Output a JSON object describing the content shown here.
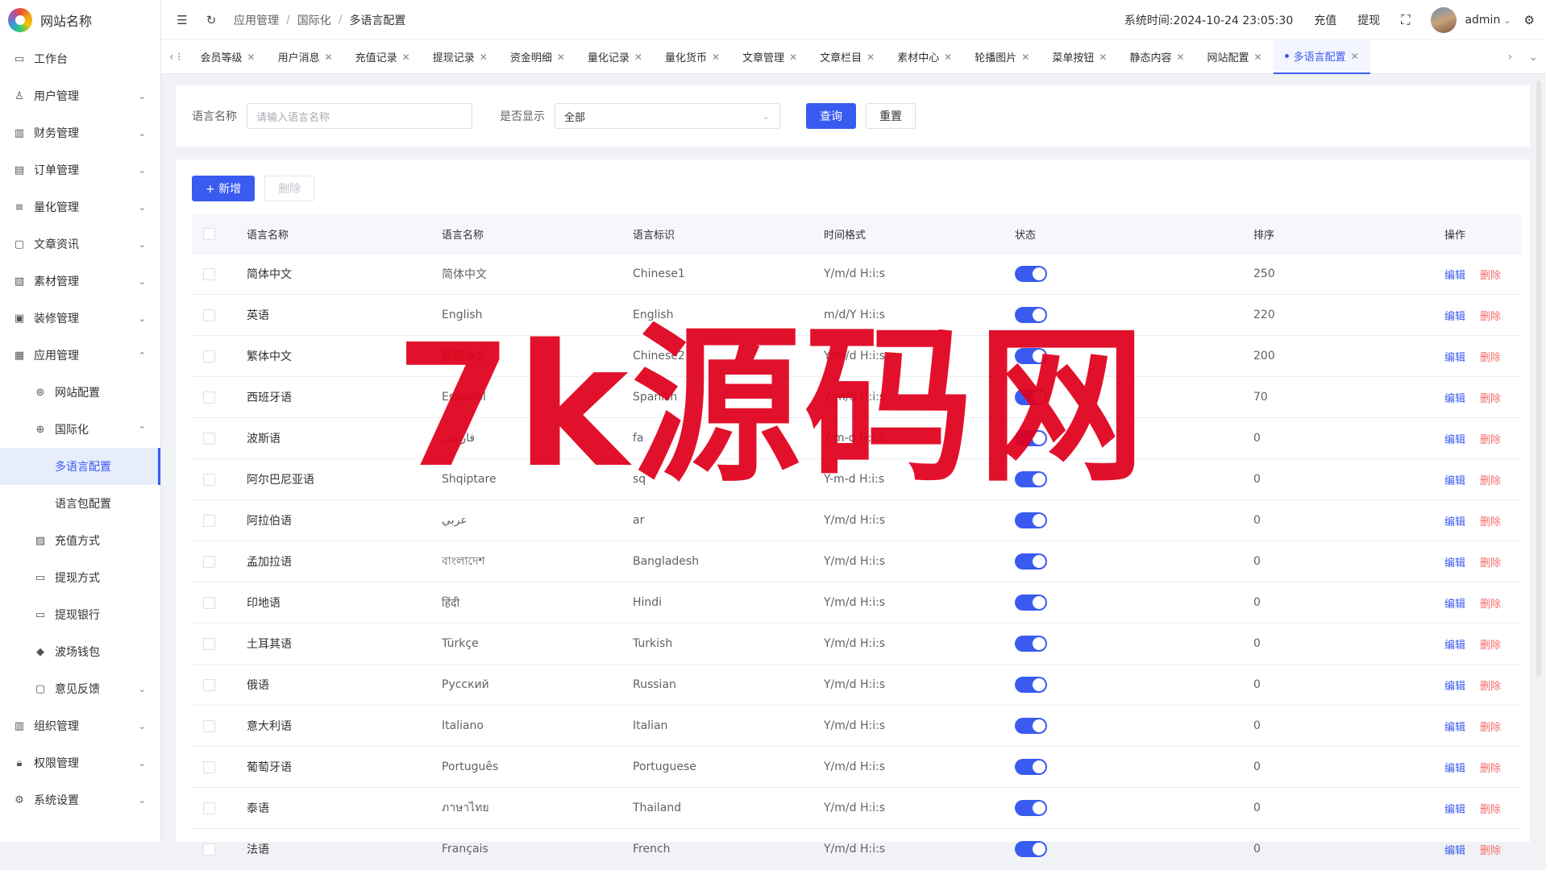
{
  "sidebar": {
    "logo_text": "网站名称",
    "items": [
      {
        "label": "工作台",
        "icon": "▭",
        "chevron": ""
      },
      {
        "label": "用户管理",
        "icon": "♙",
        "chevron": "⌄"
      },
      {
        "label": "财务管理",
        "icon": "▥",
        "chevron": "⌄"
      },
      {
        "label": "订单管理",
        "icon": "▤",
        "chevron": "⌄"
      },
      {
        "label": "量化管理",
        "icon": "≡",
        "chevron": "⌄"
      },
      {
        "label": "文章资讯",
        "icon": "▢",
        "chevron": "⌄"
      },
      {
        "label": "素材管理",
        "icon": "▧",
        "chevron": "⌄"
      },
      {
        "label": "装修管理",
        "icon": "▣",
        "chevron": "⌄"
      },
      {
        "label": "应用管理",
        "icon": "▦",
        "chevron": "⌃"
      }
    ],
    "sub_items": [
      {
        "label": "网站配置",
        "icon": "⊛",
        "level": 1,
        "chevron": ""
      },
      {
        "label": "国际化",
        "icon": "⊕",
        "level": 1,
        "chevron": "⌃"
      },
      {
        "label": "多语言配置",
        "icon": "",
        "level": 2,
        "chevron": "",
        "active": true
      },
      {
        "label": "语言包配置",
        "icon": "",
        "level": 2,
        "chevron": ""
      },
      {
        "label": "充值方式",
        "icon": "▨",
        "level": 1,
        "chevron": ""
      },
      {
        "label": "提现方式",
        "icon": "▭",
        "level": 1,
        "chevron": ""
      },
      {
        "label": "提现银行",
        "icon": "▭",
        "level": 1,
        "chevron": ""
      },
      {
        "label": "波场钱包",
        "icon": "◆",
        "level": 1,
        "chevron": ""
      },
      {
        "label": "意见反馈",
        "icon": "▢",
        "level": 1,
        "chevron": "⌄"
      }
    ],
    "bottom_items": [
      {
        "label": "组织管理",
        "icon": "▥",
        "chevron": "⌄"
      },
      {
        "label": "权限管理",
        "icon": "🔒︎",
        "chevron": "⌄"
      },
      {
        "label": "系统设置",
        "icon": "⚙",
        "chevron": "⌄"
      }
    ]
  },
  "topbar": {
    "breadcrumb": [
      "应用管理",
      "国际化",
      "多语言配置"
    ],
    "system_time_label": "系统时间:",
    "system_time": "2024-10-24 23:05:30",
    "recharge": "充值",
    "withdraw": "提现",
    "username": "admin"
  },
  "tabs": [
    {
      "label": "会员等级"
    },
    {
      "label": "用户消息"
    },
    {
      "label": "充值记录"
    },
    {
      "label": "提现记录"
    },
    {
      "label": "资金明细"
    },
    {
      "label": "量化记录"
    },
    {
      "label": "量化货币"
    },
    {
      "label": "文章管理"
    },
    {
      "label": "文章栏目"
    },
    {
      "label": "素材中心"
    },
    {
      "label": "轮播图片"
    },
    {
      "label": "菜单按钮"
    },
    {
      "label": "静态内容"
    },
    {
      "label": "网站配置"
    },
    {
      "label": "多语言配置",
      "active": true
    }
  ],
  "search": {
    "name_label": "语言名称",
    "name_placeholder": "请输入语言名称",
    "show_label": "是否显示",
    "show_value": "全部",
    "query_button": "查询",
    "reset_button": "重置"
  },
  "actions": {
    "add_button": "+ 新增",
    "delete_button": "删除"
  },
  "table": {
    "headers": [
      "语言名称",
      "语言名称",
      "语言标识",
      "时间格式",
      "状态",
      "排序",
      "操作"
    ],
    "rows": [
      {
        "name": "简体中文",
        "native": "简体中文",
        "code": "Chinese1",
        "fmt": "Y/m/d H:i:s",
        "sort": "250"
      },
      {
        "name": "英语",
        "native": "English",
        "code": "English",
        "fmt": "m/d/Y H:i:s",
        "sort": "220"
      },
      {
        "name": "繁体中文",
        "native": "繁體中文",
        "code": "Chinese2",
        "fmt": "Y/m/d H:i:s",
        "sort": "200"
      },
      {
        "name": "西班牙语",
        "native": "Español",
        "code": "Spanish",
        "fmt": "Y/m/d H:i:s",
        "sort": "70"
      },
      {
        "name": "波斯语",
        "native": "فارسی",
        "code": "fa",
        "fmt": "Y-m-d H:i:s",
        "sort": "0"
      },
      {
        "name": "阿尔巴尼亚语",
        "native": "Shqiptare",
        "code": "sq",
        "fmt": "Y-m-d H:i:s",
        "sort": "0"
      },
      {
        "name": "阿拉伯语",
        "native": "عربي",
        "code": "ar",
        "fmt": "Y/m/d H:i:s",
        "sort": "0"
      },
      {
        "name": "孟加拉语",
        "native": "বাংলাদেশ",
        "code": "Bangladesh",
        "fmt": "Y/m/d H:i:s",
        "sort": "0"
      },
      {
        "name": "印地语",
        "native": "हिंदी",
        "code": "Hindi",
        "fmt": "Y/m/d H:i:s",
        "sort": "0"
      },
      {
        "name": "土耳其语",
        "native": "Türkçe",
        "code": "Turkish",
        "fmt": "Y/m/d H:i:s",
        "sort": "0"
      },
      {
        "name": "俄语",
        "native": "Русский",
        "code": "Russian",
        "fmt": "Y/m/d H:i:s",
        "sort": "0"
      },
      {
        "name": "意大利语",
        "native": "Italiano",
        "code": "Italian",
        "fmt": "Y/m/d H:i:s",
        "sort": "0"
      },
      {
        "name": "葡萄牙语",
        "native": "Português",
        "code": "Portuguese",
        "fmt": "Y/m/d H:i:s",
        "sort": "0"
      },
      {
        "name": "泰语",
        "native": "ภาษาไทย",
        "code": "Thailand",
        "fmt": "Y/m/d H:i:s",
        "sort": "0"
      },
      {
        "name": "法语",
        "native": "Français",
        "code": "French",
        "fmt": "Y/m/d H:i:s",
        "sort": "0"
      }
    ],
    "edit_label": "编辑",
    "delete_label": "删除"
  },
  "watermark": "7k源码网",
  "colors": {
    "accent": "#3a5bf0",
    "danger": "#f56c6c",
    "watermark": "#e0001b"
  }
}
